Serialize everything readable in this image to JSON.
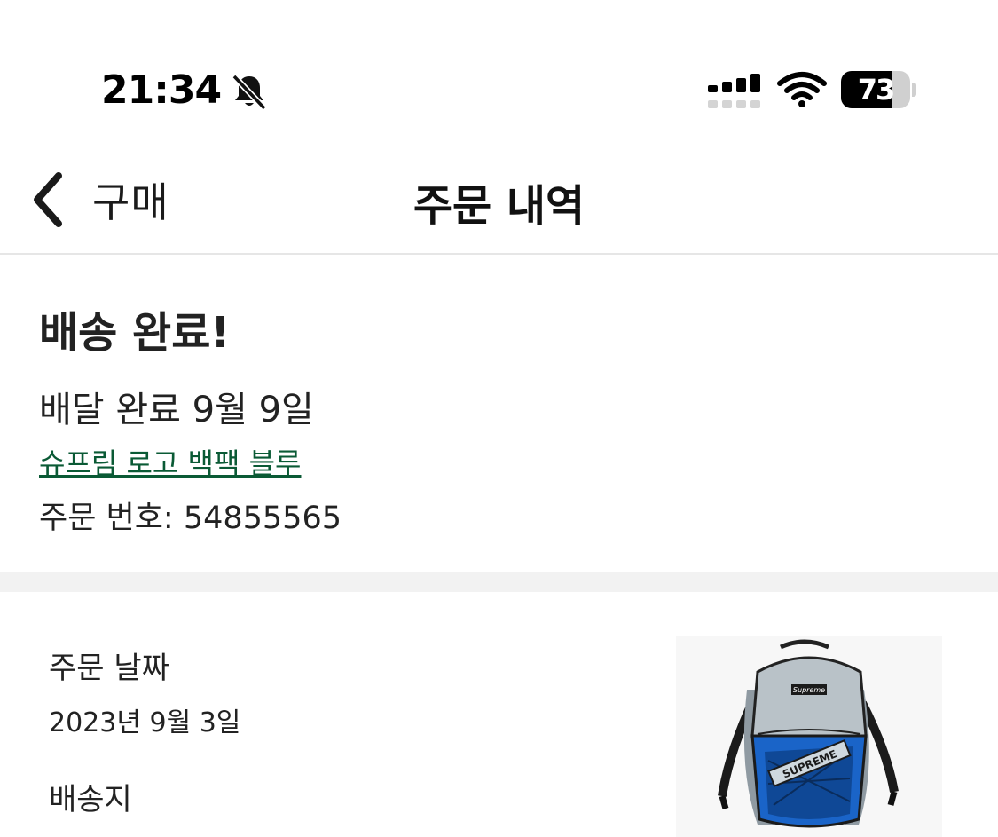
{
  "status_bar": {
    "time": "21:34",
    "battery_level": "73",
    "battery_fraction": 0.73,
    "icons": [
      "bell-slash-icon",
      "cellular-signal-icon",
      "wifi-icon",
      "battery-icon"
    ]
  },
  "nav": {
    "back_label": "구매",
    "title": "주문 내역"
  },
  "order_status": {
    "heading": "배송 완료!",
    "delivered": "배달 완료 9월 9일",
    "product_name": "슈프림 로고 백팩 블루",
    "order_number": "주문 번호: 54855565"
  },
  "details": {
    "order_date_label": "주문 날짜",
    "order_date_value": "2023년 9월 3일",
    "shipping_label": "배송지",
    "product_logo_text": "Supreme",
    "product_band_text": "SUPREME"
  },
  "colors": {
    "link": "#0a5a35",
    "divider": "#f2f2f2",
    "backpack_blue": "#1a64c8",
    "backpack_gray": "#b9c2c8"
  }
}
